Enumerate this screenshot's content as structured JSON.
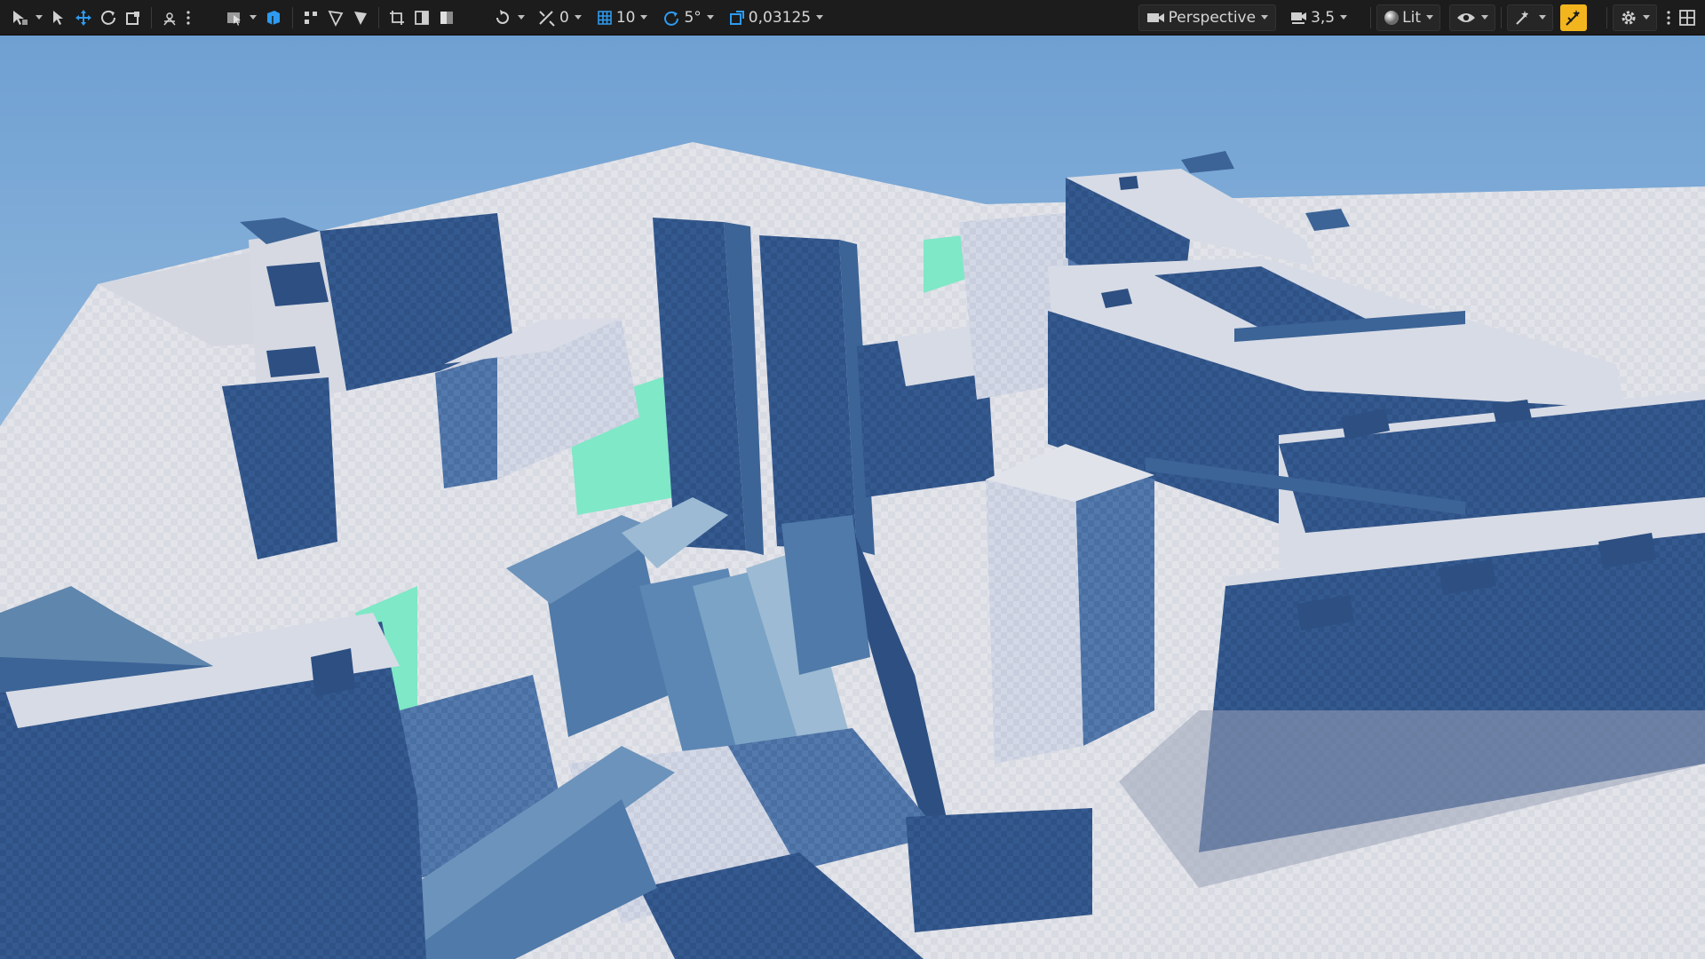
{
  "toolbar": {
    "translate_snap_value": "0",
    "grid_snap_value": "10",
    "rotation_snap_value": "5°",
    "scale_snap_value": "0,03125",
    "viewport_mode": "Perspective",
    "camera_speed": "3,5",
    "view_mode": "Lit"
  },
  "icons": {
    "select_mode": "select-mode-icon",
    "select": "pointer-icon",
    "translate": "move-icon",
    "rotate": "rotate-icon",
    "scale": "scale-icon",
    "transform_gizmo": "transform-space-icon",
    "more": "more-icon",
    "camera": "camera-icon",
    "speed": "camera-speed-icon",
    "lit": "lit-sphere-icon",
    "show": "eye-icon",
    "realtime": "realtime-icon",
    "settings": "gear-icon",
    "layout": "layout-grid-icon"
  },
  "colors": {
    "sky_top": "#6fa0d2",
    "sky_bottom": "#b9d4ea",
    "ground": "#e4e4e9",
    "building_dark": "#2d4f82",
    "building_mid": "#3c6497",
    "building_light": "#d7dbe5",
    "accent_blue": "#3aa0f0",
    "accent_yellow": "#f3b51e",
    "green_area": "#7fe8c6"
  }
}
